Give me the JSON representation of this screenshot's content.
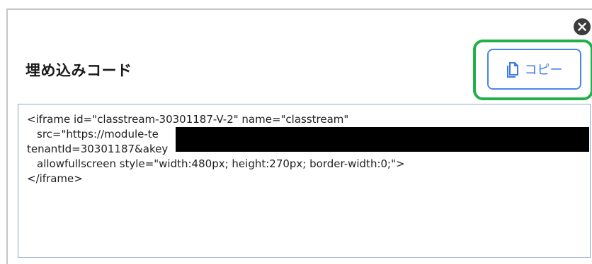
{
  "dialog": {
    "title": "埋め込みコード",
    "copy_label": "コピー",
    "close_label": "×"
  },
  "code": {
    "lines": [
      "<iframe id=\"classtream-30301187-V-2\" name=\"classtream\"",
      "src=\"https://module-te",
      "tenantId=30301187&akey",
      "allowfullscreen style=\"width:480px; height:270px; border-width:0;\">",
      "</iframe>"
    ],
    "redacted": true
  },
  "colors": {
    "accent_blue": "#4a86e8",
    "highlight_green": "#22b04a",
    "close_bg": "#3c3c3c"
  },
  "icons": {
    "copy": "document-copy-icon",
    "close": "close-icon"
  }
}
